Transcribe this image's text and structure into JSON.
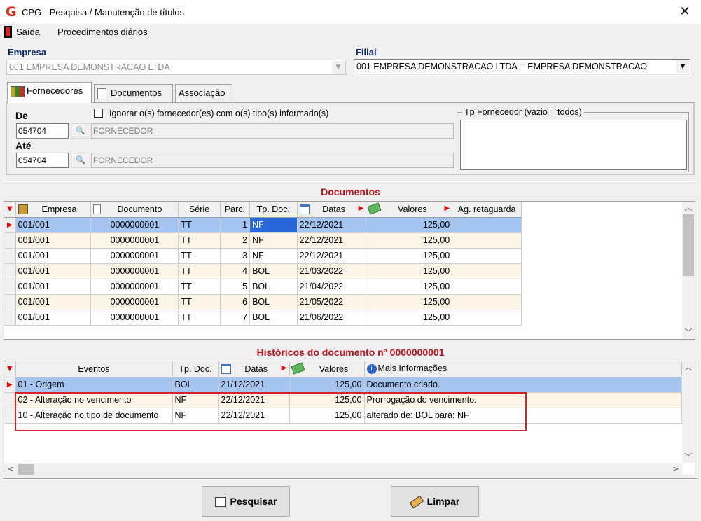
{
  "window": {
    "title": "CPG - Pesquisa / Manutenção de títulos",
    "close": "✕",
    "logo": "G"
  },
  "menu": {
    "exit": "Saída",
    "daily": "Procedimentos diários"
  },
  "empresa": {
    "label": "Empresa",
    "value": "001 EMPRESA DEMONSTRACAO LTDA"
  },
  "filial": {
    "label": "Filial",
    "value": "001 EMPRESA DEMONSTRACAO LTDA -- EMPRESA DEMONSTRACAO"
  },
  "tabs": [
    {
      "label": "Fornecedores",
      "active": true
    },
    {
      "label": "Documentos",
      "active": false
    },
    {
      "label": "Associação",
      "active": false
    }
  ],
  "filter": {
    "de_label": "De",
    "ate_label": "Até",
    "de_code": "054704",
    "ate_code": "054704",
    "de_name": "FORNECEDOR",
    "ate_name": "FORNECEDOR",
    "ignore_label": "Ignorar o(s) fornecedor(es) com o(s) tipo(s) informado(s)",
    "ignore_checked": false,
    "tp_label": "Tp Fornecedor (vazio = todos)"
  },
  "documents": {
    "title": "Documentos",
    "columns": [
      "Empresa",
      "Documento",
      "Série",
      "Parc.",
      "Tp. Doc.",
      "Datas",
      "Valores",
      "Ag. retaguarda"
    ],
    "rows": [
      [
        "001/001",
        "0000000001",
        "TT",
        "1",
        "NF",
        "22/12/2021",
        "125,00",
        ""
      ],
      [
        "001/001",
        "0000000001",
        "TT",
        "2",
        "NF",
        "22/12/2021",
        "125,00",
        ""
      ],
      [
        "001/001",
        "0000000001",
        "TT",
        "3",
        "NF",
        "22/12/2021",
        "125,00",
        ""
      ],
      [
        "001/001",
        "0000000001",
        "TT",
        "4",
        "BOL",
        "21/03/2022",
        "125,00",
        ""
      ],
      [
        "001/001",
        "0000000001",
        "TT",
        "5",
        "BOL",
        "21/04/2022",
        "125,00",
        ""
      ],
      [
        "001/001",
        "0000000001",
        "TT",
        "6",
        "BOL",
        "21/05/2022",
        "125,00",
        ""
      ],
      [
        "001/001",
        "0000000001",
        "TT",
        "7",
        "BOL",
        "21/06/2022",
        "125,00",
        ""
      ]
    ]
  },
  "history": {
    "title": "Históricos do documento nº 0000000001",
    "columns": [
      "Eventos",
      "Tp. Doc.",
      "Datas",
      "Valores",
      "Mais Informações"
    ],
    "rows": [
      [
        "01 - Origem",
        "BOL",
        "21/12/2021",
        "125,00",
        "Documento criado."
      ],
      [
        "02 - Alteração no vencimento",
        "NF",
        "22/12/2021",
        "125,00",
        "Prorrogação do vencimento."
      ],
      [
        "10 - Alteração no tipo de documento",
        "NF",
        "22/12/2021",
        "125,00",
        "alterado de: BOL para: NF"
      ]
    ]
  },
  "buttons": {
    "search": "Pesquisar",
    "clear": "Limpar"
  },
  "colors": {
    "selection": "#a5c4f0",
    "alt_row": "#fdf6e8",
    "section_title": "#c1121f",
    "highlight": "#d42426"
  }
}
